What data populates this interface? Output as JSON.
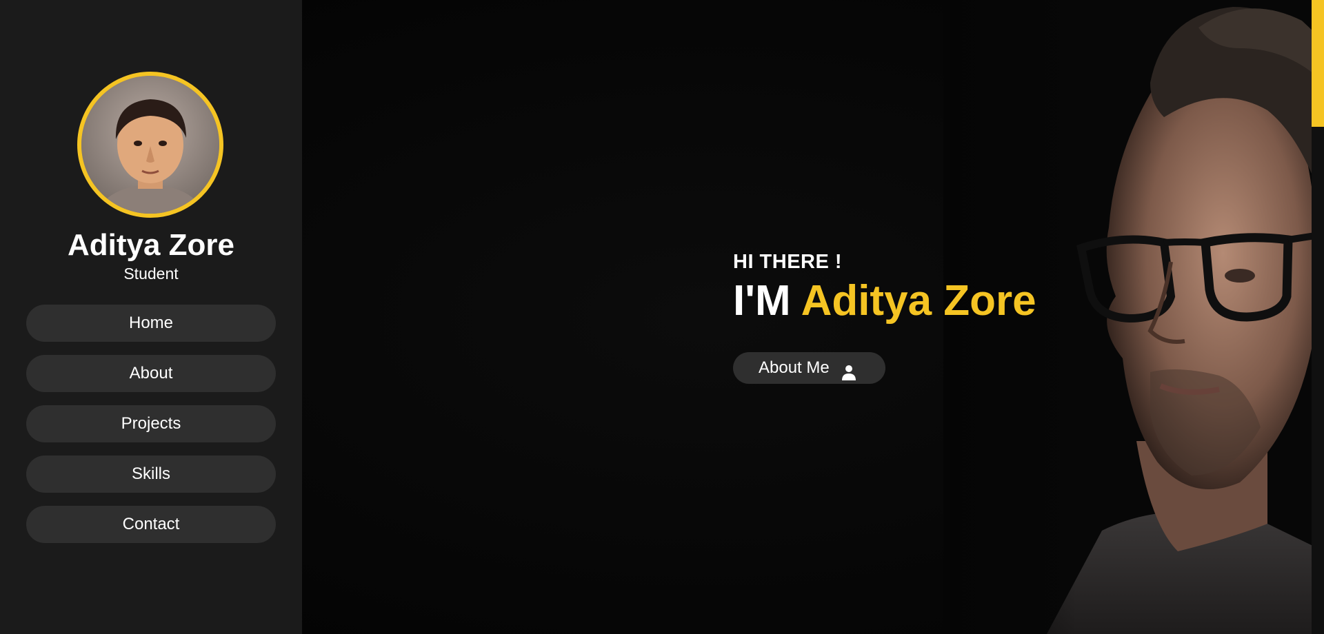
{
  "profile": {
    "name": "Aditya Zore",
    "role": "Student",
    "avatar_icon": "profile-photo"
  },
  "nav": {
    "items": [
      {
        "label": "Home"
      },
      {
        "label": "About"
      },
      {
        "label": "Projects"
      },
      {
        "label": "Skills"
      },
      {
        "label": "Contact"
      }
    ]
  },
  "hero": {
    "greeting": "HI THERE !",
    "intro": "I'M",
    "name": "Aditya Zore",
    "button": {
      "label": "About Me",
      "icon": "user-icon"
    },
    "photo_icon": "hero-portrait"
  },
  "scroll": {
    "position": 0.0
  },
  "colors": {
    "accent": "#f5c423",
    "sidebar": "#1b1b1b",
    "pill": "#2f2f2f",
    "background": "#050505"
  }
}
